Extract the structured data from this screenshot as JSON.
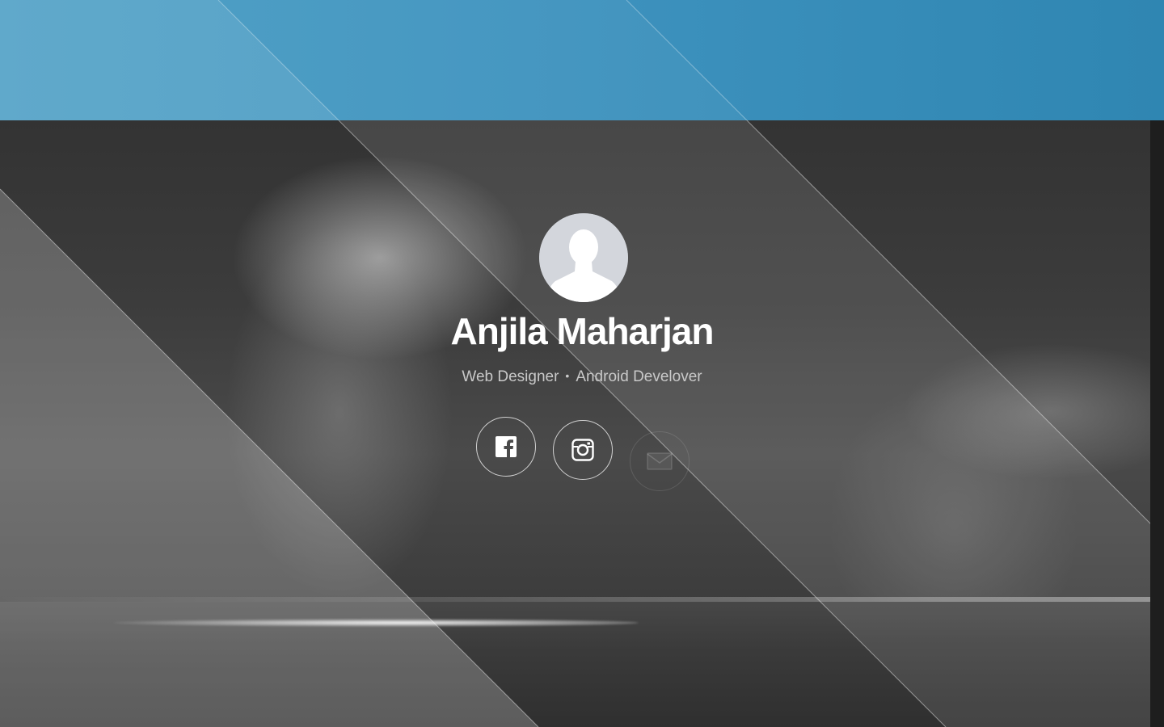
{
  "profile": {
    "name": "Anjila Maharjan",
    "roles": [
      "Web Designer",
      "Android Develover"
    ],
    "separator": "•"
  },
  "social": [
    {
      "name": "facebook",
      "icon": "facebook-icon"
    },
    {
      "name": "instagram",
      "icon": "instagram-icon"
    },
    {
      "name": "email",
      "icon": "mail-icon"
    }
  ],
  "colors": {
    "banner": "#3f93bf",
    "name_text": "#ffffff",
    "subtitle_text": "#c9c9c9",
    "avatar_bg": "#d3d6dc"
  }
}
